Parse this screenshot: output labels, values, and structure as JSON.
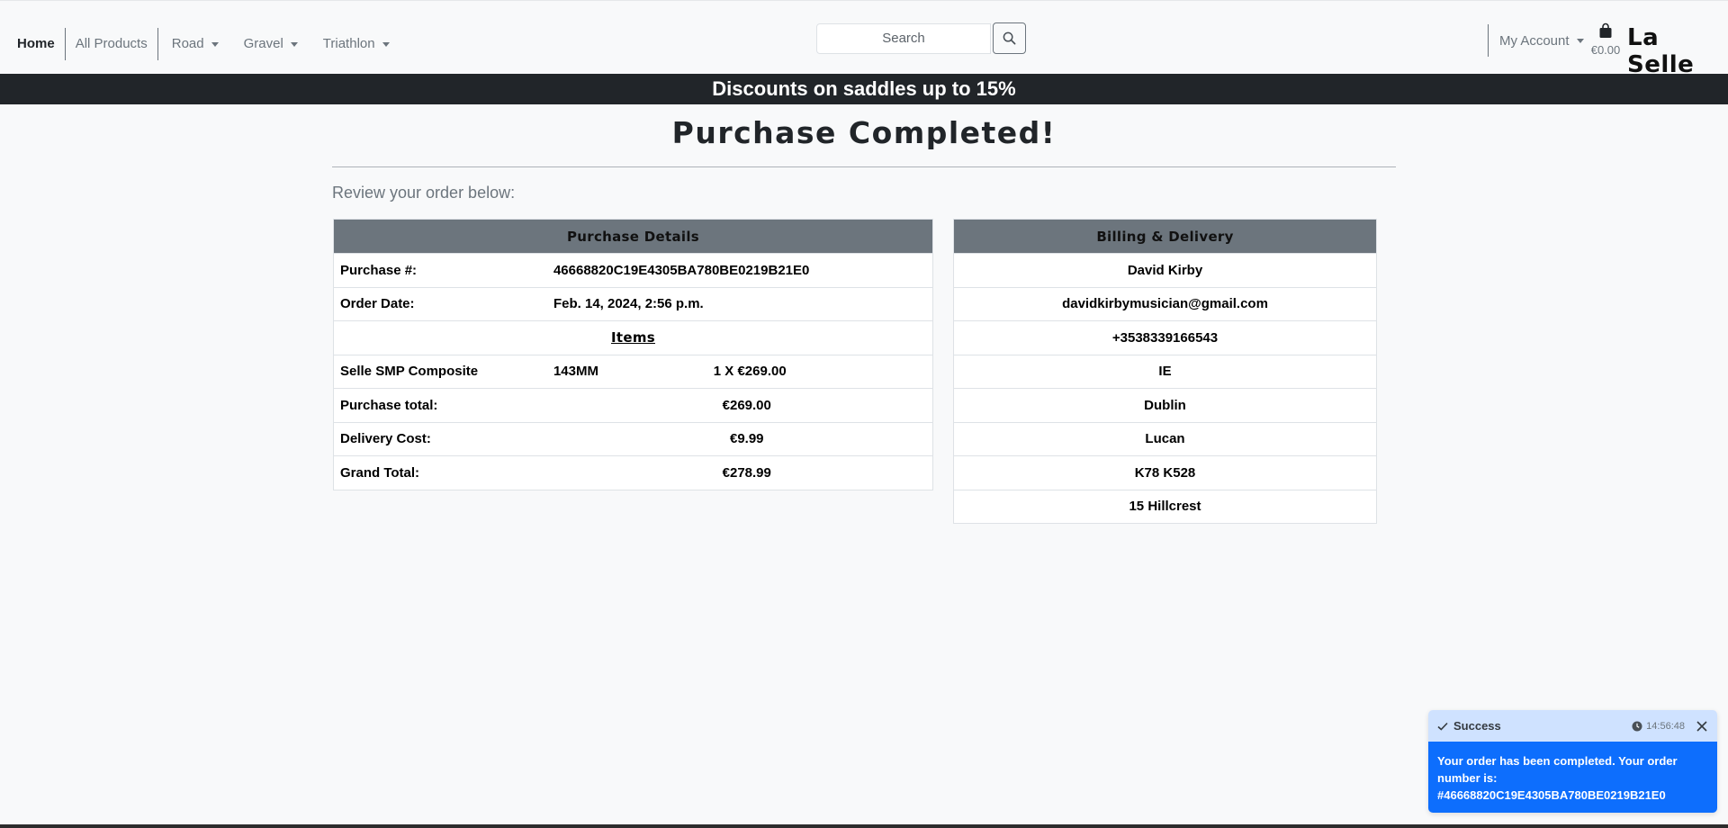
{
  "nav": {
    "home": "Home",
    "all_products": "All Products",
    "road": "Road",
    "gravel": "Gravel",
    "triathlon": "Triathlon",
    "search_placeholder": "Search",
    "my_account": "My Account",
    "bag_total": "€0.00",
    "brand": "La Selle"
  },
  "banner": "Discounts on saddles up to 15%",
  "page": {
    "title": "Purchase Completed!",
    "review": "Review your order below:"
  },
  "purchase": {
    "heading": "Purchase Details",
    "purchase_no_label": "Purchase #:",
    "purchase_no": "46668820C19E4305BA780BE0219B21E0",
    "order_date_label": "Order Date:",
    "order_date": "Feb. 14, 2024, 2:56 p.m.",
    "items_heading": "Items",
    "items": [
      {
        "name": "Selle SMP Composite",
        "size": "143MM",
        "qty_price": "1 X €269.00"
      }
    ],
    "purchase_total_label": "Purchase total:",
    "purchase_total": "€269.00",
    "delivery_label": "Delivery Cost:",
    "delivery": "€9.99",
    "grand_total_label": "Grand Total:",
    "grand_total": "€278.99"
  },
  "billing": {
    "heading": "Billing & Delivery",
    "name": "David Kirby",
    "email": "davidkirbymusician@gmail.com",
    "phone": "+3538339166543",
    "country": "IE",
    "county": "Dublin",
    "town": "Lucan",
    "postcode": "K78 K528",
    "street": "15 Hillcrest"
  },
  "toast": {
    "title": "Success",
    "time": "14:56:48",
    "message": "Your order has been completed. Your order number is: #46668820C19E4305BA780BE0219B21E0",
    "colors": {
      "header": "#cfe2ff",
      "body": "#0d6efd"
    }
  }
}
